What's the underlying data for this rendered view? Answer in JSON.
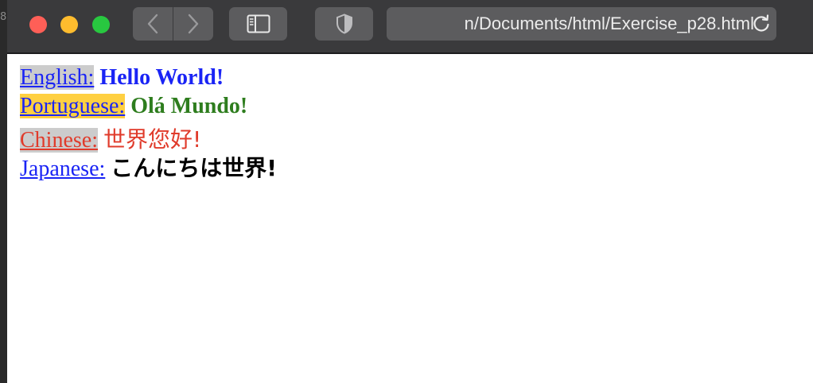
{
  "browser": {
    "url": "n/Documents/html/Exercise_p28.html",
    "left_edge_char": "8"
  },
  "colors": {
    "link_blue": "#0000ee",
    "highlight_gray": "#cccccc",
    "highlight_yellow": "#ffd042",
    "english_text": "#1a24f5",
    "portuguese_text": "#2e7d1e",
    "chinese_text": "#e03b2b",
    "japanese_text": "#000000"
  },
  "lines": [
    {
      "label": "English:",
      "greeting": "Hello World!"
    },
    {
      "label": "Portuguese:",
      "greeting": "Olá Mundo!"
    },
    {
      "label": "Chinese:",
      "greeting": "世界您好!"
    },
    {
      "label": "Japanese:",
      "greeting": "こんにちは世界!"
    }
  ]
}
